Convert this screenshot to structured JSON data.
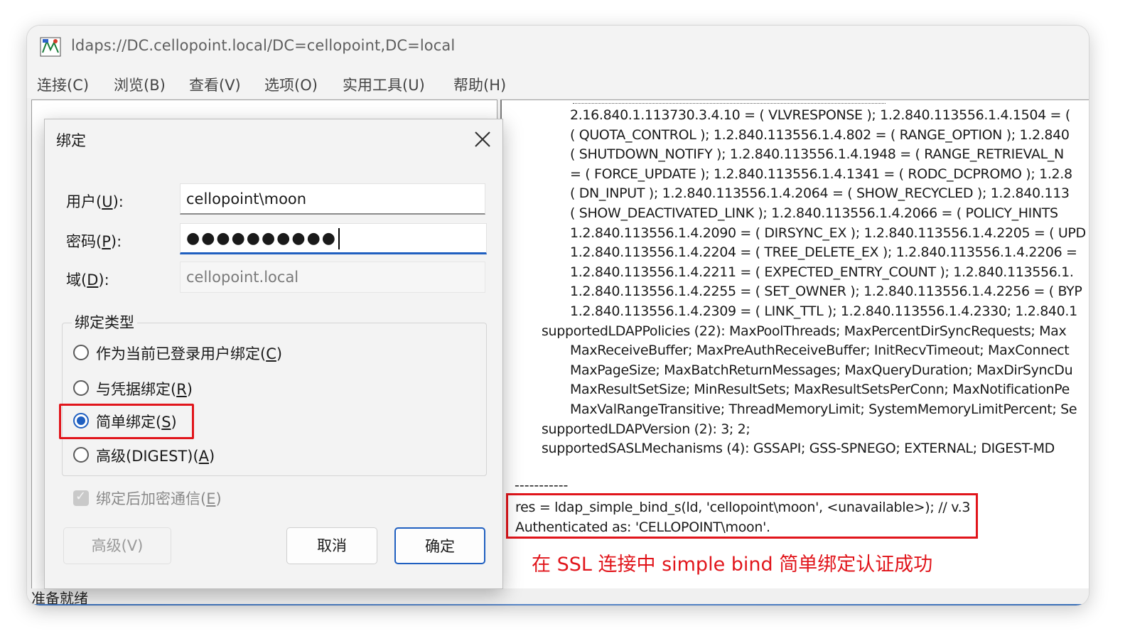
{
  "window": {
    "title": "ldaps://DC.cellopoint.local/DC=cellopoint,DC=local"
  },
  "menu": {
    "items": [
      {
        "label": "连接(C)"
      },
      {
        "label": "浏览(B)"
      },
      {
        "label": "查看(V)"
      },
      {
        "label": "选项(O)"
      },
      {
        "label": "实用工具(U)"
      },
      {
        "label": "帮助(H)"
      }
    ]
  },
  "log": {
    "lines": [
      "2.16.840.1.113730.3.4.10 = ( VLVRESPONSE ); 1.2.840.113556.1.4.1504 = (",
      "( QUOTA_CONTROL ); 1.2.840.113556.1.4.802 = ( RANGE_OPTION ); 1.2.840",
      "( SHUTDOWN_NOTIFY ); 1.2.840.113556.1.4.1948 = ( RANGE_RETRIEVAL_N",
      "= ( FORCE_UPDATE ); 1.2.840.113556.1.4.1341 = ( RODC_DCPROMO ); 1.2.8",
      "( DN_INPUT ); 1.2.840.113556.1.4.2064 = ( SHOW_RECYCLED ); 1.2.840.113",
      "( SHOW_DEACTIVATED_LINK ); 1.2.840.113556.1.4.2066 = ( POLICY_HINTS",
      "1.2.840.113556.1.4.2090 = ( DIRSYNC_EX ); 1.2.840.113556.1.4.2205 = ( UPD",
      "1.2.840.113556.1.4.2204 = ( TREE_DELETE_EX ); 1.2.840.113556.1.4.2206 =",
      "1.2.840.113556.1.4.2211 = ( EXPECTED_ENTRY_COUNT ); 1.2.840.113556.1.",
      "1.2.840.113556.1.4.2255 = ( SET_OWNER ); 1.2.840.113556.1.4.2256 = ( BYP",
      "1.2.840.113556.1.4.2309 = ( LINK_TTL ); 1.2.840.113556.1.4.2330; 1.2.840.1",
      "supportedLDAPPolicies (22): MaxPoolThreads; MaxPercentDirSyncRequests; Max",
      "MaxReceiveBuffer; MaxPreAuthReceiveBuffer; InitRecvTimeout; MaxConnect",
      "MaxPageSize; MaxBatchReturnMessages; MaxQueryDuration; MaxDirSyncDu",
      "MaxResultSetSize; MinResultSets; MaxResultSetsPerConn; MaxNotificationPe",
      "MaxValRangeTransitive; ThreadMemoryLimit; SystemMemoryLimitPercent; Se",
      "supportedLDAPVersion (2): 3; 2;",
      "supportedSASLMechanisms (4): GSSAPI; GSS-SPNEGO; EXTERNAL; DIGEST-MD"
    ],
    "separator": "-----------",
    "bind_call": "res = ldap_simple_bind_s(ld, 'cellopoint\\moon', <unavailable>); // v.3",
    "auth_result": "Authenticated as: 'CELLOPOINT\\moon'."
  },
  "annotation": "在 SSL 连接中 simple bind 简单绑定认证成功",
  "status": {
    "text": "准备就绪"
  },
  "dialog": {
    "title": "绑定",
    "user": {
      "label_prefix": "用户(",
      "label_key": "U",
      "label_suffix": "):",
      "value": "cellopoint\\moon"
    },
    "password": {
      "label_prefix": "密码(",
      "label_key": "P",
      "label_suffix": "):",
      "value": "●●●●●●●●●●"
    },
    "domain": {
      "label_prefix": "域(",
      "label_key": "D",
      "label_suffix": "):",
      "value": "cellopoint.local"
    },
    "bind_type": {
      "legend": "绑定类型",
      "options": [
        {
          "prefix": "作为当前已登录用户绑定(",
          "key": "C",
          "suffix": ")",
          "checked": false
        },
        {
          "prefix": "与凭据绑定(",
          "key": "R",
          "suffix": ")",
          "checked": false
        },
        {
          "prefix": "简单绑定(",
          "key": "S",
          "suffix": ")",
          "checked": true
        },
        {
          "prefix": "高级(DIGEST)(",
          "key": "A",
          "suffix": ")",
          "checked": false
        }
      ]
    },
    "encrypt": {
      "prefix": "绑定后加密通信(",
      "key": "E",
      "suffix": ")",
      "checked": true,
      "disabled": true
    },
    "buttons": {
      "advanced": "高级(V)",
      "cancel": "取消",
      "ok": "确定"
    },
    "accent_color": "#1f5fc0",
    "highlight_color": "#e1151b"
  }
}
